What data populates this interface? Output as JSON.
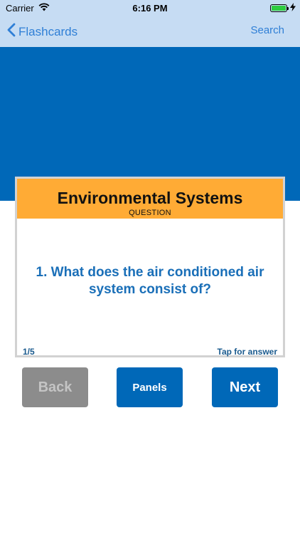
{
  "status_bar": {
    "carrier": "Carrier",
    "time": "6:16 PM",
    "battery_level": 1.0,
    "charging": true
  },
  "nav": {
    "back_label": "Flashcards",
    "search_label": "Search"
  },
  "card": {
    "title": "Environmental Systems",
    "subtitle": "QUESTION",
    "question": "1. What does the air conditioned air system consist of?",
    "counter": "1/5",
    "hint": "Tap for answer"
  },
  "buttons": {
    "back": "Back",
    "panels": "Panels",
    "next": "Next"
  },
  "colors": {
    "nav_background": "#c6dcf3",
    "accent_blue": "#0068b8",
    "header_orange": "#ffab35",
    "link_blue": "#2f7fd6",
    "disabled_gray": "#8c8c8c"
  }
}
